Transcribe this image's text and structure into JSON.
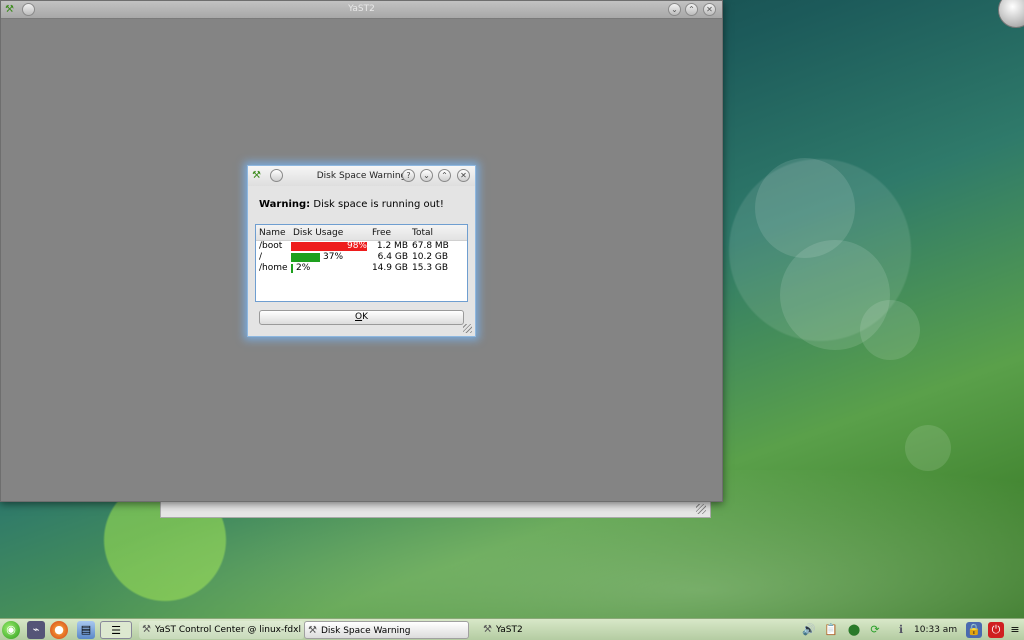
{
  "main_window": {
    "title": "YaST2"
  },
  "dialog": {
    "title": "Disk Space Warning",
    "warning_label": "Warning:",
    "warning_text": " Disk space is running out!",
    "columns": [
      "Name",
      "Disk Usage",
      "Free",
      "Total"
    ],
    "rows": [
      {
        "name": "/boot",
        "usage": 98,
        "usage_label": "98%",
        "free": "1.2 MB",
        "total": "67.8 MB",
        "bar_color": "#ee1c1c"
      },
      {
        "name": "/",
        "usage": 37,
        "usage_label": "37%",
        "free": "6.4 GB",
        "total": "10.2 GB",
        "bar_color": "#1ea01e"
      },
      {
        "name": "/home",
        "usage": 2,
        "usage_label": "2%",
        "free": "14.9 GB",
        "total": "15.3 GB",
        "bar_color": "#1ea01e"
      }
    ],
    "ok_mnemonic": "O",
    "ok_rest": "K"
  },
  "taskbar": {
    "tasks": [
      {
        "label": "YaST Control Center @ linux-fdxl"
      },
      {
        "label": "Disk Space Warning"
      },
      {
        "label": "YaST2"
      }
    ],
    "clock": "10:33 am"
  },
  "icons": {
    "kickoff": "opensuse-icon",
    "firefox": "firefox-icon",
    "volume": "speaker-icon",
    "logout": "power-icon"
  }
}
